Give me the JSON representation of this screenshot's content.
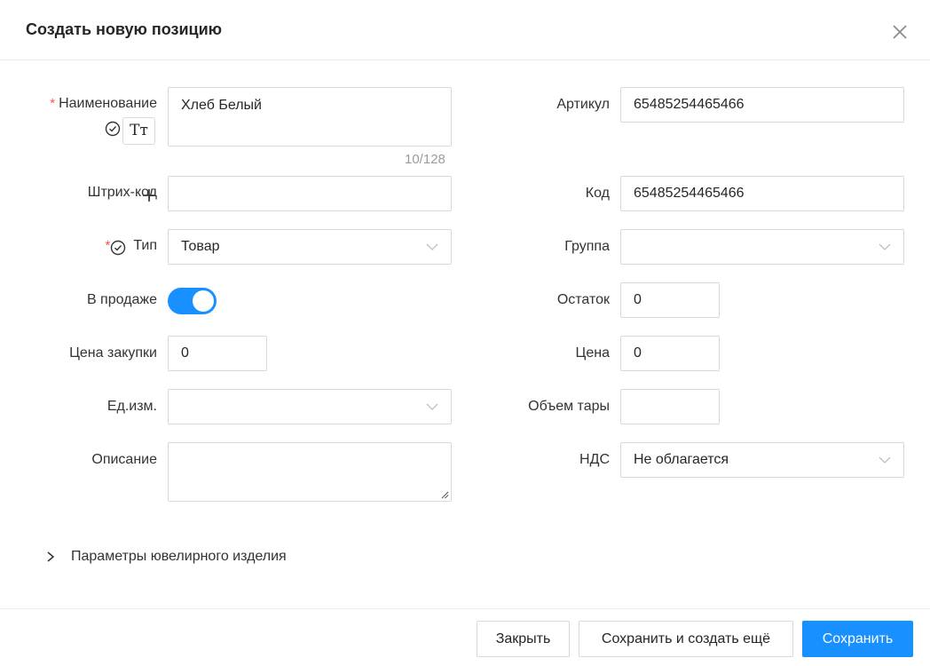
{
  "dialog": {
    "title": "Создать новую позицию"
  },
  "left": {
    "name_label": "Наименование",
    "name_value": "Хлеб Белый",
    "name_counter": "10/128",
    "tt_label": "Tт",
    "barcode_label": "Штрих-код",
    "barcode_value": "",
    "type_label": "Тип",
    "type_value": "Товар",
    "on_sale_label": "В продаже",
    "on_sale_enabled": true,
    "purchase_price_label": "Цена закупки",
    "purchase_price_value": "0",
    "unit_label": "Ед.изм.",
    "unit_value": "",
    "description_label": "Описание",
    "description_value": ""
  },
  "right": {
    "article_label": "Артикул",
    "article_value": "65485254465466",
    "code_label": "Код",
    "code_value": "65485254465466",
    "group_label": "Группа",
    "group_value": "",
    "stock_label": "Остаток",
    "stock_value": "0",
    "price_label": "Цена",
    "price_value": "0",
    "volume_label": "Объем тары",
    "volume_value": "",
    "vat_label": "НДС",
    "vat_value": "Не облагается"
  },
  "jewelry_section_label": "Параметры ювелирного изделия",
  "footer": {
    "close_label": "Закрыть",
    "save_and_new_label": "Сохранить и создать ещё",
    "save_label": "Сохранить"
  },
  "colors": {
    "primary": "#1890ff",
    "required": "#ff4d4f",
    "border": "#d9d9d9"
  }
}
